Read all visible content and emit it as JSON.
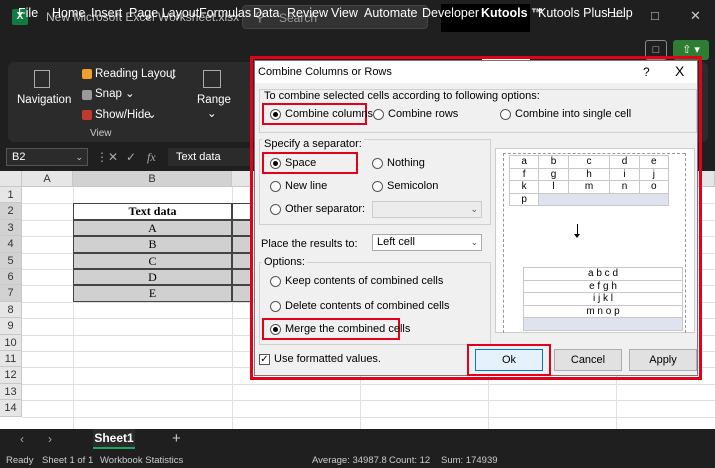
{
  "window": {
    "title": "New Microsoft Excel Worksheet.xlsx",
    "search_placeholder": "Search",
    "app_icon_letter": "X"
  },
  "menu": [
    "File",
    "Home",
    "Insert",
    "Page Layout",
    "Formulas",
    "Data",
    "Review",
    "View",
    "Automate",
    "Developer",
    "Kutools ™",
    "Kutools Plus",
    "Help"
  ],
  "ribbon": {
    "navigation": "Navigation",
    "reading_layout": "Reading Layout",
    "snap": "Snap",
    "show_hide": "Show/Hide",
    "group_view": "View",
    "range": "Range"
  },
  "formula_bar": {
    "name_box": "B2",
    "fx": "fx",
    "value": "Text data"
  },
  "grid": {
    "columns": [
      "A",
      "B"
    ],
    "rows": [
      "1",
      "2",
      "3",
      "4",
      "5",
      "6",
      "7",
      "8",
      "9",
      "10",
      "11",
      "12",
      "13",
      "14"
    ],
    "header_cell": "Text data",
    "data_cells": [
      "A",
      "B",
      "C",
      "D",
      "E"
    ]
  },
  "sheets": {
    "active": "Sheet1",
    "add": "+"
  },
  "status": {
    "ready": "Ready",
    "sheet_of": "Sheet 1 of 1",
    "workbook_stats": "Workbook Statistics",
    "average": "Average: 34987.8",
    "count": "Count: 12",
    "sum": "Sum: 174939"
  },
  "dialog": {
    "title": "Combine Columns or Rows",
    "help": "?",
    "close": "X",
    "prompt": "To combine selected cells according to following options:",
    "combine_options": [
      {
        "label": "Combine columns",
        "selected": true
      },
      {
        "label": "Combine rows",
        "selected": false
      },
      {
        "label": "Combine into single cell",
        "selected": false
      }
    ],
    "separator_title": "Specify a separator:",
    "separators": [
      {
        "label": "Space",
        "selected": true
      },
      {
        "label": "Nothing",
        "selected": false
      },
      {
        "label": "New line",
        "selected": false
      },
      {
        "label": "Semicolon",
        "selected": false
      },
      {
        "label": "Other separator:",
        "selected": false
      }
    ],
    "place_results_label": "Place the results to:",
    "place_results_value": "Left cell",
    "options_title": "Options:",
    "options": [
      {
        "label": "Keep contents of combined cells",
        "selected": false
      },
      {
        "label": "Delete contents of combined cells",
        "selected": false
      },
      {
        "label": "Merge the combined cells",
        "selected": true
      }
    ],
    "use_formatted": "Use formatted values.",
    "use_formatted_checked": true,
    "buttons": {
      "ok": "Ok",
      "cancel": "Cancel",
      "apply": "Apply"
    },
    "preview_before": [
      [
        "a",
        "b",
        "c",
        "d",
        "e"
      ],
      [
        "f",
        "g",
        "h",
        "i",
        "j"
      ],
      [
        "k",
        "l",
        "m",
        "n",
        "o"
      ],
      [
        "p",
        "",
        "",
        "",
        ""
      ]
    ],
    "preview_after": [
      "a b c d",
      "e f g h",
      "i j k l",
      "m n o p"
    ]
  }
}
